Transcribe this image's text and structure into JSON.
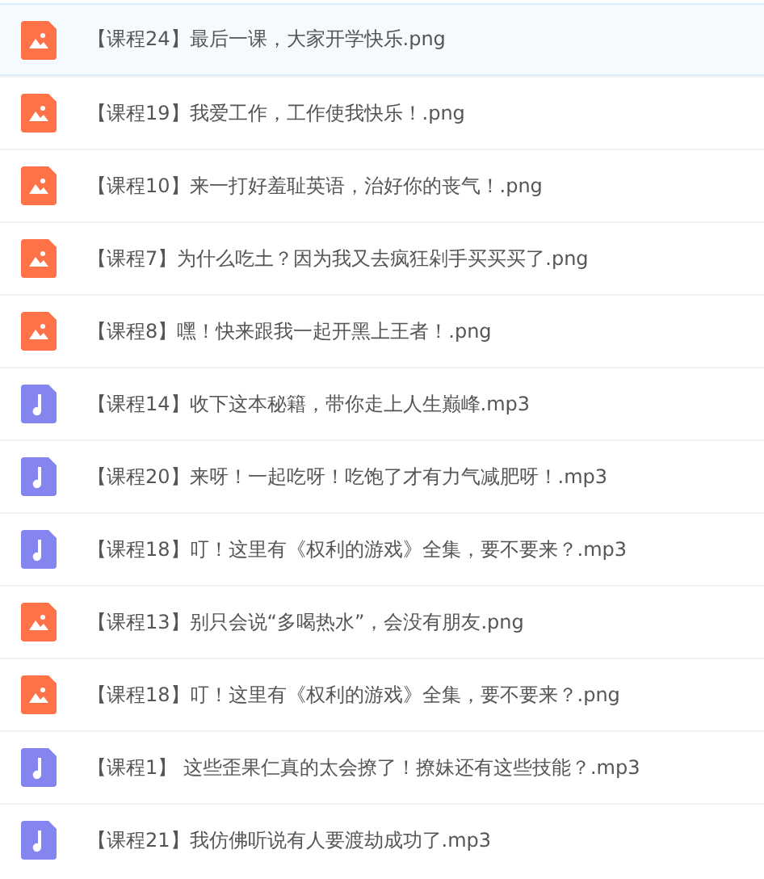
{
  "files": [
    {
      "kind": "image",
      "name": "【课程24】最后一课，大家开学快乐.png",
      "selected": true
    },
    {
      "kind": "image",
      "name": "【课程19】我爱工作，工作使我快乐！.png",
      "selected": false
    },
    {
      "kind": "image",
      "name": "【课程10】来一打好羞耻英语，治好你的丧气！.png",
      "selected": false
    },
    {
      "kind": "image",
      "name": "【课程7】为什么吃土？因为我又去疯狂剁手买买买了.png",
      "selected": false
    },
    {
      "kind": "image",
      "name": "【课程8】嘿！快来跟我一起开黑上王者！.png",
      "selected": false
    },
    {
      "kind": "audio",
      "name": "【课程14】收下这本秘籍，带你走上人生巅峰.mp3",
      "selected": false
    },
    {
      "kind": "audio",
      "name": "【课程20】来呀！一起吃呀！吃饱了才有力气减肥呀！.mp3",
      "selected": false
    },
    {
      "kind": "audio",
      "name": "【课程18】叮！这里有《权利的游戏》全集，要不要来？.mp3",
      "selected": false
    },
    {
      "kind": "image",
      "name": "【课程13】别只会说“多喝热水”，会没有朋友.png",
      "selected": false
    },
    {
      "kind": "image",
      "name": "【课程18】叮！这里有《权利的游戏》全集，要不要来？.png",
      "selected": false
    },
    {
      "kind": "audio",
      "name": "【课程1】 这些歪果仁真的太会撩了！撩妹还有这些技能？.mp3",
      "selected": false
    },
    {
      "kind": "audio",
      "name": "【课程21】我仿佛听说有人要渡劫成功了.mp3",
      "selected": false
    }
  ]
}
